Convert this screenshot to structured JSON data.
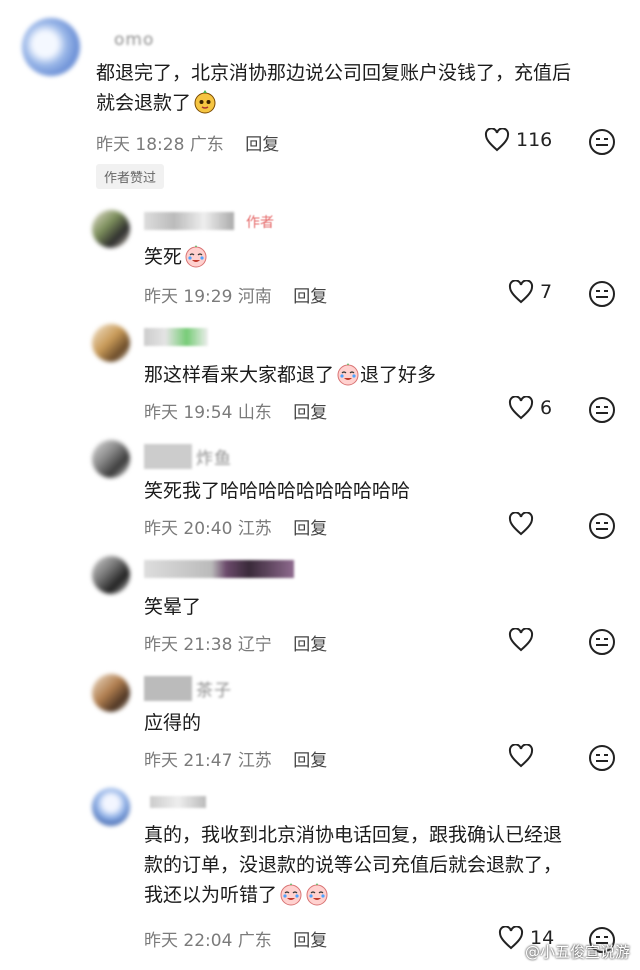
{
  "comments": [
    {
      "name": " omo",
      "text_lines": [
        "都退完了，北京消协那边说公司回复账户没钱了，充值后",
        "就会退款了"
      ],
      "time": "昨天 18:28",
      "location": "广东",
      "reply_label": "回复",
      "likes": "116",
      "badge": "作者赞过"
    },
    {
      "name": "",
      "author_tag": "作者",
      "text_lines": [
        "笑死"
      ],
      "time": "昨天 19:29",
      "location": "河南",
      "reply_label": "回复",
      "likes": "7"
    },
    {
      "name": "",
      "text_lines": [
        "那这样看来大家都退了",
        "退了好多"
      ],
      "time": "昨天 19:54",
      "location": "山东",
      "reply_label": "回复",
      "likes": "6"
    },
    {
      "name": "炸鱼",
      "text_lines": [
        "笑死我了哈哈哈哈哈哈哈哈哈哈"
      ],
      "time": "昨天 20:40",
      "location": "江苏",
      "reply_label": "回复",
      "likes": ""
    },
    {
      "name": "",
      "text_lines": [
        "笑晕了"
      ],
      "time": "昨天 21:38",
      "location": "辽宁",
      "reply_label": "回复",
      "likes": ""
    },
    {
      "name": "茶子",
      "text_lines": [
        "应得的"
      ],
      "time": "昨天 21:47",
      "location": "江苏",
      "reply_label": "回复",
      "likes": ""
    },
    {
      "name": "",
      "text_lines": [
        "真的，我收到北京消协电话回复，跟我确认已经退",
        "款的订单，没退款的说等公司充值后就会退款了，",
        "我还以为听错了"
      ],
      "time": "昨天 22:04",
      "location": "广东",
      "reply_label": "回复",
      "likes": "14"
    }
  ],
  "watermark": "@小五俊宣说游",
  "icons": {
    "like": "heart-outline-icon",
    "smile": "smile-face-icon",
    "emoji_cry": "crying-laugh-emoji",
    "emoji_cute": "cute-face-emoji"
  },
  "colors": {
    "author_tag": "#e56b6b",
    "meta": "#7b7b7b",
    "badge_bg": "#f1f1f1"
  }
}
